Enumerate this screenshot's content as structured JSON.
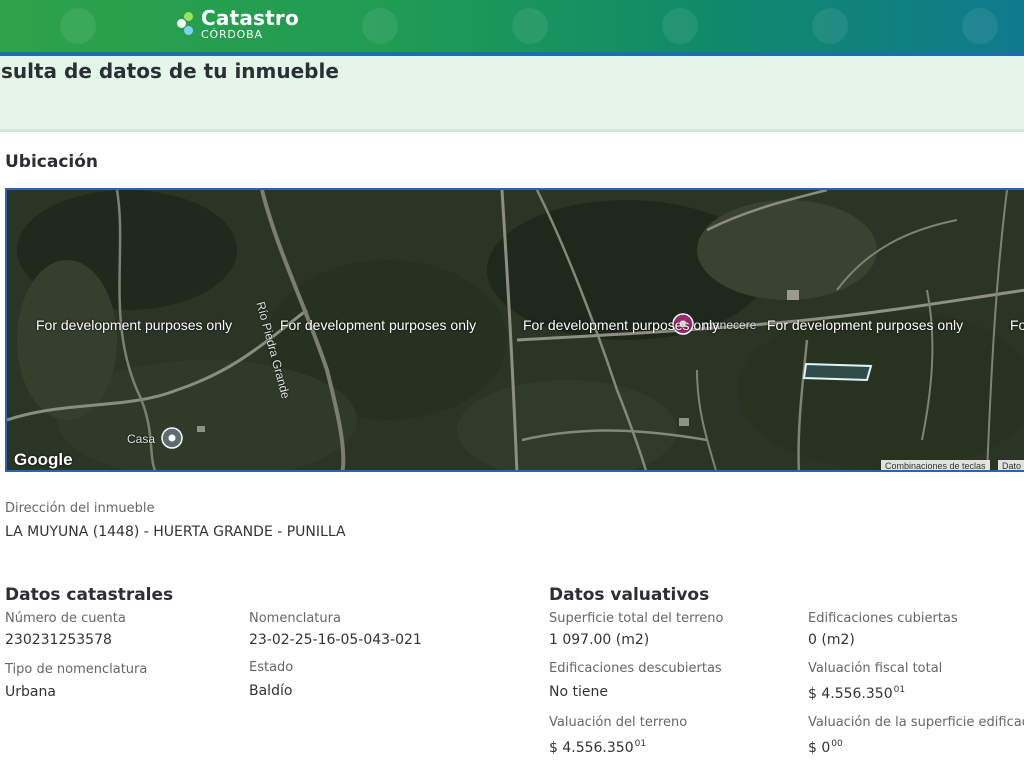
{
  "header": {
    "logo_title": "Catastro",
    "logo_subtitle": "CÓRDOBA",
    "colors": {
      "bar_start": "#2ea24a",
      "bar_end": "#0f7a8e",
      "accent_line": "#1e6fa5"
    }
  },
  "page": {
    "title": "sulta de datos de tu inmueble"
  },
  "ubicacion": {
    "heading": "Ubicación",
    "map": {
      "watermark": "For development purposes only",
      "watermark_partial": "Fo",
      "river_label": "Río Piedra Grande",
      "place_label": "Casa",
      "place_label_2": "manecere",
      "google_logo": "Google",
      "attribution_shortcuts": "Combinaciones de teclas",
      "attribution_data": "Dato"
    }
  },
  "direccion": {
    "label": "Dirección del inmueble",
    "value": "LA MUYUNA (1448) - HUERTA GRANDE - PUNILLA"
  },
  "catastrales": {
    "heading": "Datos catastrales",
    "numero_cuenta_label": "Número de cuenta",
    "numero_cuenta": "230231253578",
    "nomenclatura_label": "Nomenclatura",
    "nomenclatura": "23-02-25-16-05-043-021",
    "tipo_label": "Tipo de nomenclatura",
    "tipo": "Urbana",
    "estado_label": "Estado",
    "estado": "Baldío"
  },
  "valuativos": {
    "heading": "Datos valuativos",
    "superficie_label": "Superficie total del terreno",
    "superficie": "1 097.00 (m2)",
    "edif_cubiertas_label": "Edificaciones cubiertas",
    "edif_cubiertas": "0 (m2)",
    "edif_descubiertas_label": "Edificaciones descubiertas",
    "edif_descubiertas": "No tiene",
    "val_fiscal_label": "Valuación fiscal total",
    "val_fiscal": "$ 4.556.350",
    "val_fiscal_cents": "01",
    "val_terreno_label": "Valuación del terreno",
    "val_terreno": "$ 4.556.350",
    "val_terreno_cents": "01",
    "val_sup_edificada_label": "Valuación de la superficie edificada t",
    "val_sup_edificada": "$ 0",
    "val_sup_edificada_cents": "00"
  }
}
